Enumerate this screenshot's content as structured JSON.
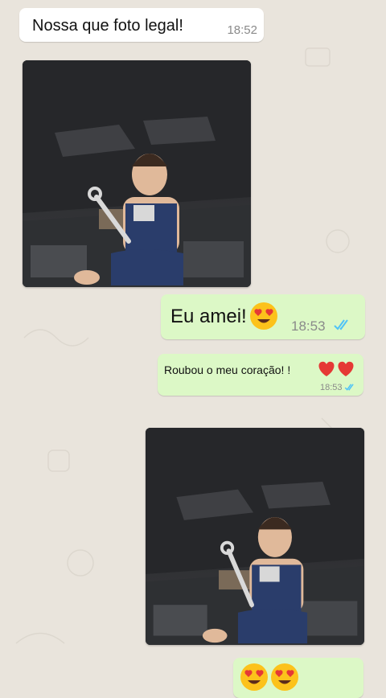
{
  "chat": {
    "messages": [
      {
        "type": "text",
        "direction": "incoming",
        "text": "Nossa que foto legal!",
        "time": "18:52"
      },
      {
        "type": "photo",
        "direction": "incoming"
      },
      {
        "type": "text",
        "direction": "outgoing",
        "text": "Eu amei!",
        "time": "18:53",
        "emoji": "heart-eyes-icon",
        "read": true
      },
      {
        "type": "text",
        "direction": "outgoing",
        "text": "Roubou o meu coração!  !",
        "time": "18:53",
        "emoji": "red-heart-icon",
        "read": true
      },
      {
        "type": "photo",
        "direction": "outgoing"
      },
      {
        "type": "emoji",
        "direction": "outgoing",
        "emoji": "heart-eyes-icon"
      }
    ]
  },
  "colors": {
    "incoming_bubble": "#ffffff",
    "outgoing_bubble": "#dcf8c6",
    "read_ticks": "#4fc3f7",
    "background": "#e9e4dc"
  }
}
